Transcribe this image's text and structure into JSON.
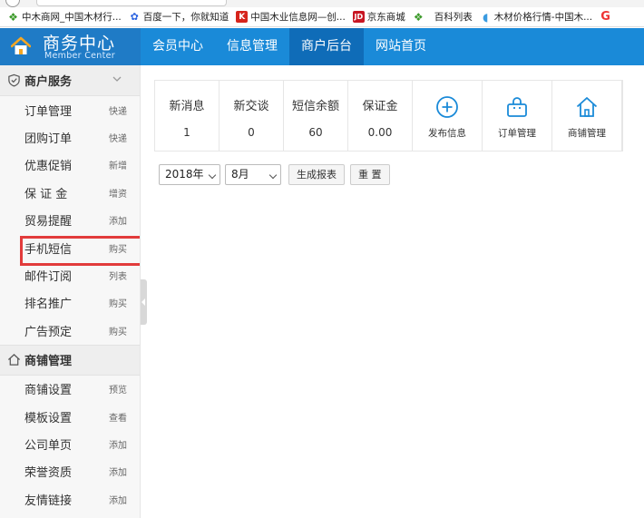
{
  "bookmarks": [
    {
      "icon": "leaf-icon",
      "label": "中木商网_中国木材行..."
    },
    {
      "icon": "baidu-paw-icon",
      "label": "百度一下，你就知道"
    },
    {
      "icon": "k-logo-icon",
      "label": "中国木业信息网—创..."
    },
    {
      "icon": "jd-icon",
      "label": "京东商城"
    },
    {
      "icon": "leaf-icon",
      "label": "百科列表"
    },
    {
      "icon": "c-logo-icon",
      "label": "木材价格行情-中国木..."
    }
  ],
  "header": {
    "title": "商务中心",
    "subtitle": "Member Center",
    "nav": [
      {
        "label": "会员中心"
      },
      {
        "label": "信息管理"
      },
      {
        "label": "商户后台",
        "active": true
      },
      {
        "label": "网站首页"
      }
    ]
  },
  "sidebar": {
    "sections": [
      {
        "title": "商户服务",
        "icon": "shield-icon",
        "items": [
          {
            "label": "订单管理",
            "tag": "快递"
          },
          {
            "label": "团购订单",
            "tag": "快递"
          },
          {
            "label": "优惠促销",
            "tag": "新增"
          },
          {
            "label": "保 证 金",
            "tag": "增资"
          },
          {
            "label": "贸易提醒",
            "tag": "添加"
          },
          {
            "label": "手机短信",
            "tag": "购买",
            "highlight": true
          },
          {
            "label": "邮件订阅",
            "tag": "列表"
          },
          {
            "label": "排名推广",
            "tag": "购买"
          },
          {
            "label": "广告预定",
            "tag": "购买"
          }
        ]
      },
      {
        "title": "商铺管理",
        "icon": "home-icon",
        "items": [
          {
            "label": "商铺设置",
            "tag": "预览"
          },
          {
            "label": "模板设置",
            "tag": "查看"
          },
          {
            "label": "公司单页",
            "tag": "添加"
          },
          {
            "label": "荣誉资质",
            "tag": "添加"
          },
          {
            "label": "友情链接",
            "tag": "添加"
          }
        ]
      }
    ]
  },
  "stats": [
    {
      "label": "新消息",
      "value": "1"
    },
    {
      "label": "新交谈",
      "value": "0"
    },
    {
      "label": "短信余额",
      "value": "60"
    },
    {
      "label": "保证金",
      "value": "0.00"
    }
  ],
  "quick_actions": [
    {
      "label": "发布信息",
      "icon": "plus-circle-icon"
    },
    {
      "label": "订单管理",
      "icon": "bag-icon"
    },
    {
      "label": "商铺管理",
      "icon": "home-icon"
    }
  ],
  "filters": {
    "year": "2018年",
    "month": "8月",
    "generate_label": "生成报表",
    "reset_label": "重 置"
  },
  "colors": {
    "header": "#1a8ad8",
    "header_active": "#0f6cb8",
    "accent_icon": "#1a8ad8",
    "highlight_border": "#e23b3b"
  }
}
